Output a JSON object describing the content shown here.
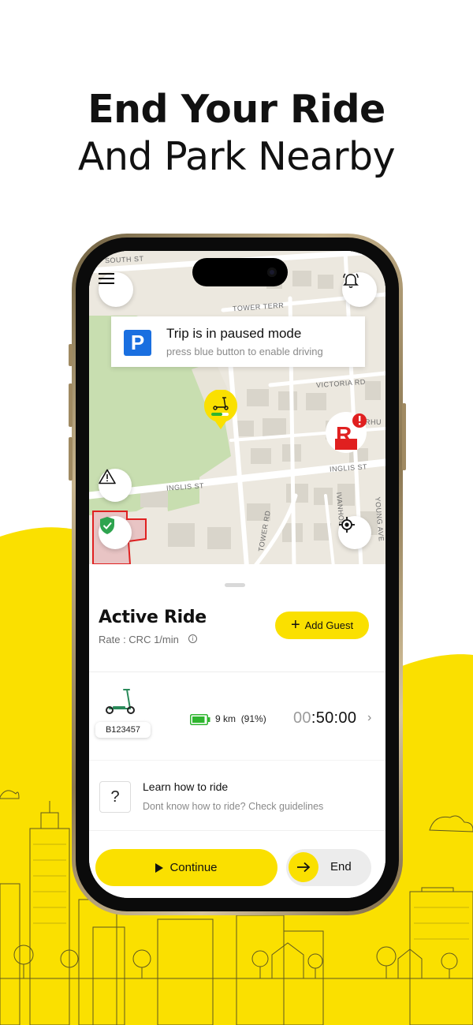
{
  "headline": {
    "line1": "End Your Ride",
    "line2": "And Park Nearby"
  },
  "colors": {
    "accent": "#fae000",
    "parking_blue": "#1a6fe0",
    "battery_green": "#2fb52f",
    "safe_green": "#2ea44f",
    "alert_red": "#e02020"
  },
  "map": {
    "streets": [
      "SOUTH ST",
      "TOWER TERR",
      "VICTORIA RD",
      "RHU",
      "INGLIS ST",
      "INGLIS ST",
      "TOWER RD",
      "IVANHOE ST",
      "YOUNG AVE"
    ],
    "icons": [
      "menu-icon",
      "bell-icon",
      "warning-icon",
      "shield-check-icon",
      "locate-icon",
      "scooter-marker-icon",
      "restricted-zone-icon"
    ]
  },
  "trip_banner": {
    "icon_letter": "P",
    "title": "Trip is in paused mode",
    "subtitle": "press blue button to enable driving"
  },
  "active_ride": {
    "title": "Active Ride",
    "rate": "Rate : CRC 1/min",
    "rate_info_icon": "i",
    "add_guest_plus": "+",
    "add_guest_label": "Add Guest"
  },
  "vehicle": {
    "id": "B123457",
    "battery_level": 0.91,
    "range": "9 km",
    "battery_pct": "(91%)",
    "timer_dim": "00",
    "timer_main": ":50:00",
    "chevron": "›"
  },
  "learn": {
    "icon": "?",
    "title": "Learn how to ride",
    "subtitle": "Dont know how to ride? Check guidelines"
  },
  "actions": {
    "continue_label": "Continue",
    "end_label": "End"
  }
}
